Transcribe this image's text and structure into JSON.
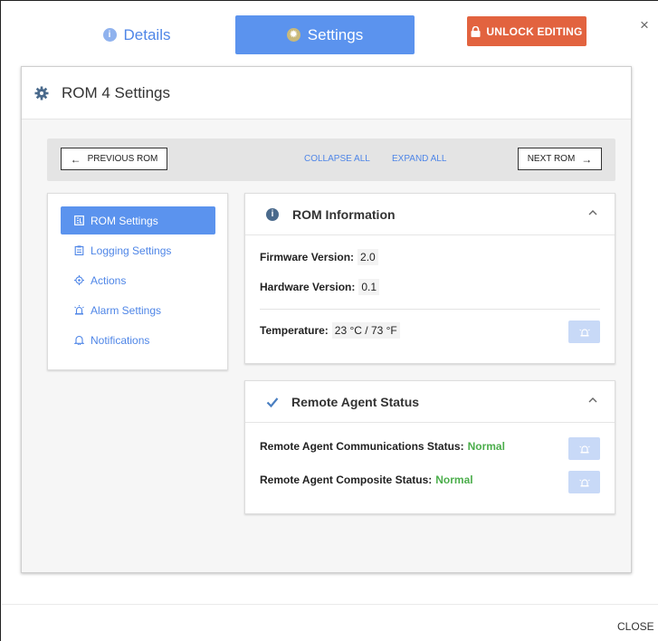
{
  "tabs": {
    "details_label": "Details",
    "settings_label": "Settings"
  },
  "unlock_label": "UNLOCK EDITING",
  "close_x": "×",
  "panel": {
    "title": "ROM 4 Settings"
  },
  "nav": {
    "prev_label": "PREVIOUS ROM",
    "next_label": "NEXT ROM",
    "collapse_label": "COLLAPSE ALL",
    "expand_label": "EXPAND ALL"
  },
  "menu": {
    "items": [
      {
        "label": "ROM Settings",
        "icon": "rom-settings-icon",
        "active": true
      },
      {
        "label": "Logging Settings",
        "icon": "clipboard-icon",
        "active": false
      },
      {
        "label": "Actions",
        "icon": "target-icon",
        "active": false
      },
      {
        "label": "Alarm Settings",
        "icon": "siren-icon",
        "active": false
      },
      {
        "label": "Notifications",
        "icon": "bell-icon",
        "active": false
      }
    ]
  },
  "rom_info": {
    "title": "ROM Information",
    "firmware_label": "Firmware Version:",
    "firmware_value": "2.0",
    "hardware_label": "Hardware Version:",
    "hardware_value": "0.1",
    "temperature_label": "Temperature:",
    "temperature_value": "23 °C / 73 °F"
  },
  "remote_agent": {
    "title": "Remote Agent Status",
    "comm_label": "Remote Agent Communications Status:",
    "comm_value": "Normal",
    "composite_label": "Remote Agent Composite Status:",
    "composite_value": "Normal"
  },
  "footer": {
    "close_label": "CLOSE"
  },
  "colors": {
    "accent": "#5b93ee",
    "unlock": "#e2633f",
    "status_ok": "#4cae4c",
    "alarm_button": "#c8d9f7"
  }
}
